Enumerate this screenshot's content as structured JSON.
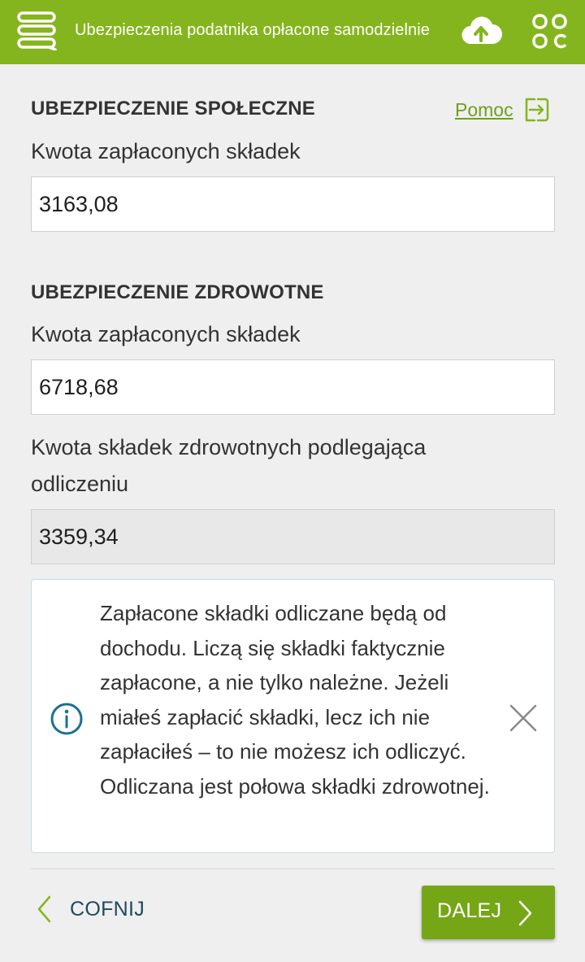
{
  "header": {
    "title": "Ubezpieczenia podatnika opłacone samodzielnie",
    "menu_icon": "menu-icon",
    "cloud_icon": "cloud-upload-icon",
    "apps_icon": "apps-grid-icon"
  },
  "social": {
    "heading": "UBEZPIECZENIE SPOŁECZNE",
    "help_label": "Pomoc",
    "paid_label": "Kwota zapłaconych składek",
    "paid_value": "3163,08"
  },
  "health": {
    "heading": "UBEZPIECZENIE ZDROWOTNE",
    "paid_label": "Kwota zapłaconych składek",
    "paid_value": "6718,68",
    "deductible_label": "Kwota składek zdrowotnych podlegająca odliczeniu",
    "deductible_value": "3359,34"
  },
  "info": {
    "text": "Zapłacone składki odliczane będą od dochodu. Liczą się składki faktycznie zapłacone, a nie tylko należne. Jeżeli miałeś zapłacić składki, lecz ich nie zapłaciłeś – to nie możesz ich odliczyć. Odliczana jest połowa składki zdrowotnej."
  },
  "footer": {
    "back_label": "COFNIJ",
    "next_label": "DALEJ"
  },
  "colors": {
    "brand_green": "#85b51e",
    "button_green": "#75a616",
    "link_green": "#6f9f1b",
    "info_blue": "#1f6e96"
  }
}
